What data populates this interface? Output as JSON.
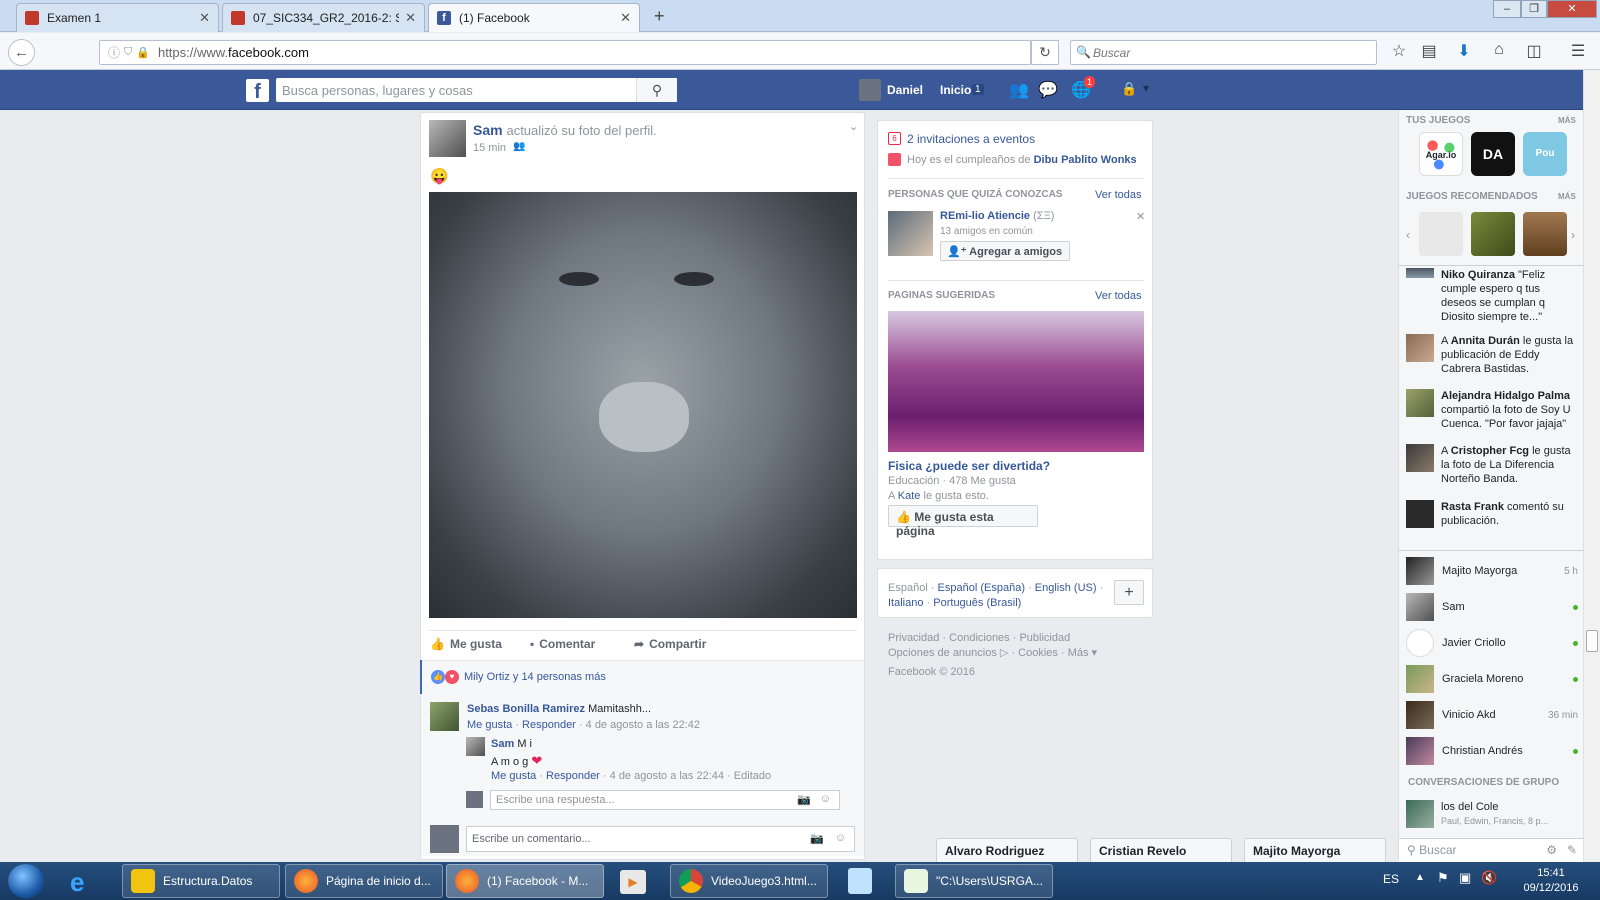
{
  "browser": {
    "tabs": [
      {
        "title": "Examen 1",
        "color": "#c0392b"
      },
      {
        "title": "07_SIC334_GR2_2016-2: Su...",
        "color": "#c0392b"
      },
      {
        "title": "(1) Facebook",
        "color": "#3b5998"
      }
    ],
    "url_prefix": "https://www.",
    "url_domain": "facebook.com",
    "search_placeholder": "Buscar"
  },
  "fb_header": {
    "search_placeholder": "Busca personas, lugares y cosas",
    "user_name": "Daniel",
    "home_label": "Inicio",
    "home_count": "1",
    "notification_count": "1"
  },
  "post": {
    "author": "Sam",
    "action": "actualizó su foto del perfil.",
    "time": "15 min",
    "emoji": "😛",
    "actions": {
      "like": "Me gusta",
      "comment": "Comentar",
      "share": "Compartir"
    },
    "reactions_text": "Mily Ortiz y 14 personas más",
    "comments": [
      {
        "author": "Sebas Bonilla Ramirez",
        "text": "Mamitashh...",
        "like": "Me gusta",
        "reply": "Responder",
        "date": "4 de agosto a las 22:42"
      }
    ],
    "reply": {
      "author": "Sam",
      "line1": "M i",
      "line2": "A m o g",
      "like": "Me gusta",
      "reply": "Responder",
      "date": "4 de agosto a las 22:44",
      "edited": "Editado"
    },
    "reply_placeholder": "Escribe una respuesta...",
    "comment_placeholder": "Escribe un comentario..."
  },
  "right": {
    "events": "2 invitaciones a eventos",
    "birthday_prefix": "Hoy es el cumpleaños de",
    "birthday_name": "Dibu Pablito Wonks",
    "pymk_title": "PERSONAS QUE QUIZÁ CONOZCAS",
    "see_all": "Ver todas",
    "pymk_name": "REmi-lio Atiencie",
    "pymk_alt": "(ΣΞ)",
    "pymk_mutual": "13 amigos en común",
    "add_friend": "Agregar a amigos",
    "pages_title": "PAGINAS SUGERIDAS",
    "page_name": "Fisica ¿puede ser divertida?",
    "page_meta": "Educación · 478 Me gusta",
    "page_like_prefix": "A",
    "page_like_name": "Kate",
    "page_like_suffix": "le gusta esto.",
    "like_page_btn": "Me gusta esta página",
    "languages": {
      "current": "Español",
      "others": [
        "Español (España)",
        "English (US)",
        "Italiano",
        "Português (Brasil)"
      ]
    },
    "footer_row1": [
      "Privacidad",
      "Condiciones",
      "Publicidad"
    ],
    "footer_row2": [
      "Opciones de anuncios",
      "Cookies",
      "Más"
    ],
    "copyright": "Facebook © 2016"
  },
  "sidebar": {
    "your_games": "TUS JUEGOS",
    "more": "MÁS",
    "recommended": "JUEGOS RECOMENDADOS",
    "games": [
      "Agar.io",
      "DA",
      "Pou"
    ],
    "ticker": [
      {
        "name": "Niko Quiranza",
        "text": "\"Feliz cumple espero q tus deseos se cumplan q Diosito siempre te...\""
      },
      {
        "prefix": "A",
        "name": "Annita Durán",
        "text": "le gusta la publicación de Eddy Cabrera Bastidas."
      },
      {
        "name": "Alejandra Hidalgo Palma",
        "text": "compartió la foto de Soy U Cuenca. \"Por favor jajaja\""
      },
      {
        "prefix": "A",
        "name": "Cristopher Fcg",
        "text": "le gusta la foto de La Diferencia Norteño Banda."
      },
      {
        "name": "Rasta Frank",
        "text": "comentó su publicación."
      }
    ],
    "contacts": [
      {
        "name": "Majito Mayorga",
        "status": "5 h"
      },
      {
        "name": "Sam",
        "status": "online"
      },
      {
        "name": "Javier Criollo",
        "status": "online"
      },
      {
        "name": "Graciela Moreno",
        "status": "online"
      },
      {
        "name": "Vinicio Akd",
        "status": "36 min"
      },
      {
        "name": "Christian Andrés",
        "status": "online"
      }
    ],
    "group_title": "CONVERSACIONES DE GRUPO",
    "group_name": "los del Cole",
    "group_members": "Paul, Edwin, Francis, 8 p...",
    "search_placeholder": "Buscar"
  },
  "chat_tabs": [
    "Alvaro Rodriguez",
    "Cristian Revelo",
    "Majito Mayorga"
  ],
  "taskbar": {
    "items": [
      "Estructura.Datos",
      "Página de inicio d...",
      "(1) Facebook - M...",
      "VideoJuego3.html...",
      "\"C:\\Users\\USRGA..."
    ],
    "lang": "ES",
    "time": "15:41",
    "date": "09/12/2016"
  },
  "colors": {
    "fb_blue": "#3b5998",
    "link": "#365899",
    "online": "#42b72a"
  }
}
